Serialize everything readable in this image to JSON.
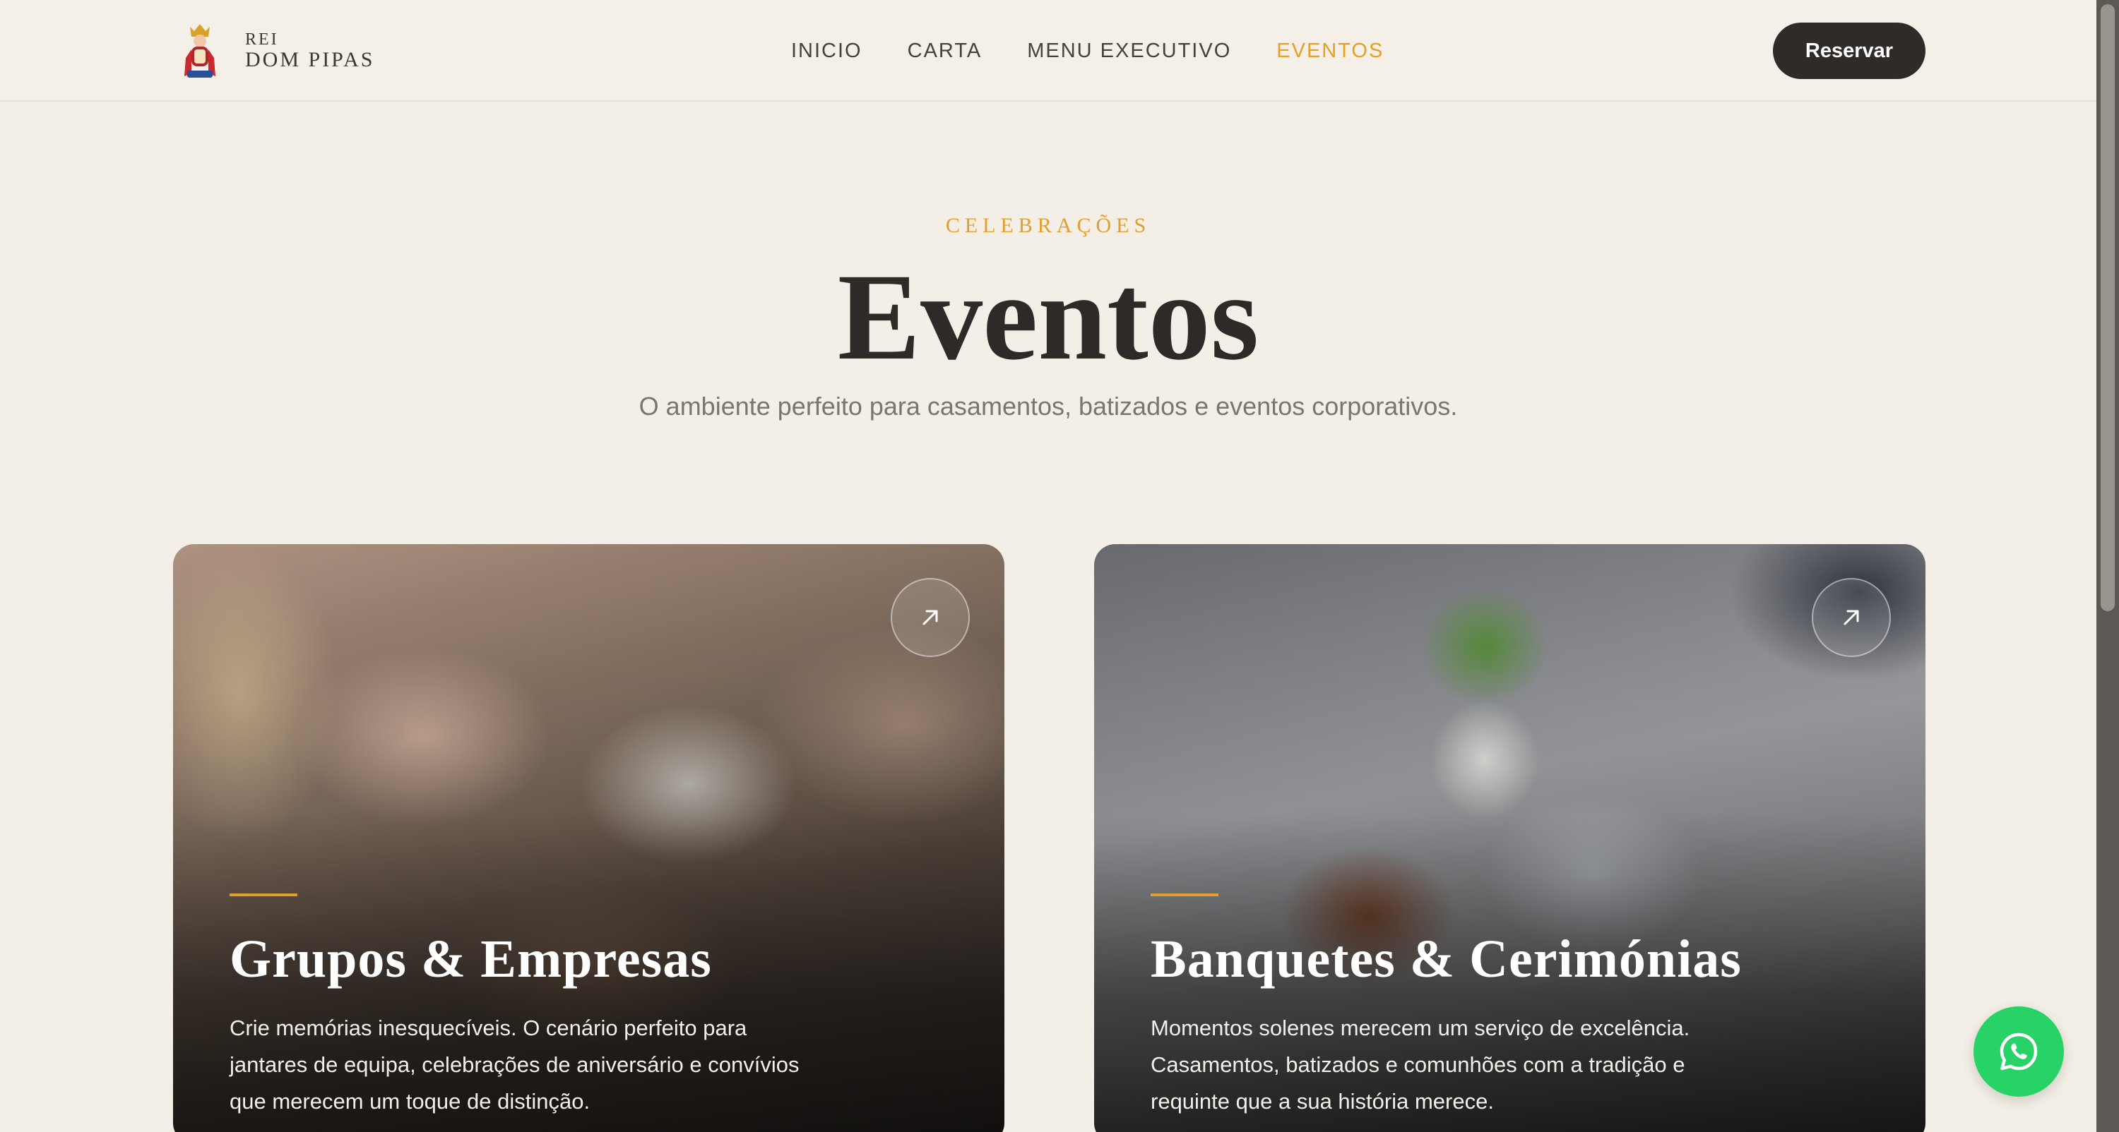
{
  "brand": {
    "line1": "REI",
    "line2": "DOM PIPAS"
  },
  "nav": {
    "items": [
      {
        "label": "INICIO"
      },
      {
        "label": "CARTA"
      },
      {
        "label": "MENU EXECUTIVO"
      },
      {
        "label": "EVENTOS",
        "active": true
      }
    ],
    "active_color": "#e6a024"
  },
  "header": {
    "reserve_label": "Reservar"
  },
  "hero": {
    "eyebrow": "CELEBRAÇÕES",
    "title": "Eventos",
    "subtitle": "O ambiente perfeito para casamentos, batizados e eventos corporativos."
  },
  "cards": [
    {
      "title": "Grupos & Empresas",
      "text_lines": [
        "Crie memórias inesquecíveis. O cenário perfeito para",
        "jantares de equipa, celebrações de aniversário e convívios",
        "que merecem um toque de distinção."
      ],
      "icon": "arrow-up-right-icon"
    },
    {
      "title": "Banquetes & Cerimónias",
      "text_lines": [
        "Momentos solenes merecem um serviço de excelência.",
        "Casamentos, batizados e comunhões com a tradição e",
        "requinte que a sua história merece."
      ],
      "icon": "arrow-up-right-icon"
    }
  ],
  "whatsapp": {
    "icon": "whatsapp-icon",
    "color": "#27d366"
  }
}
